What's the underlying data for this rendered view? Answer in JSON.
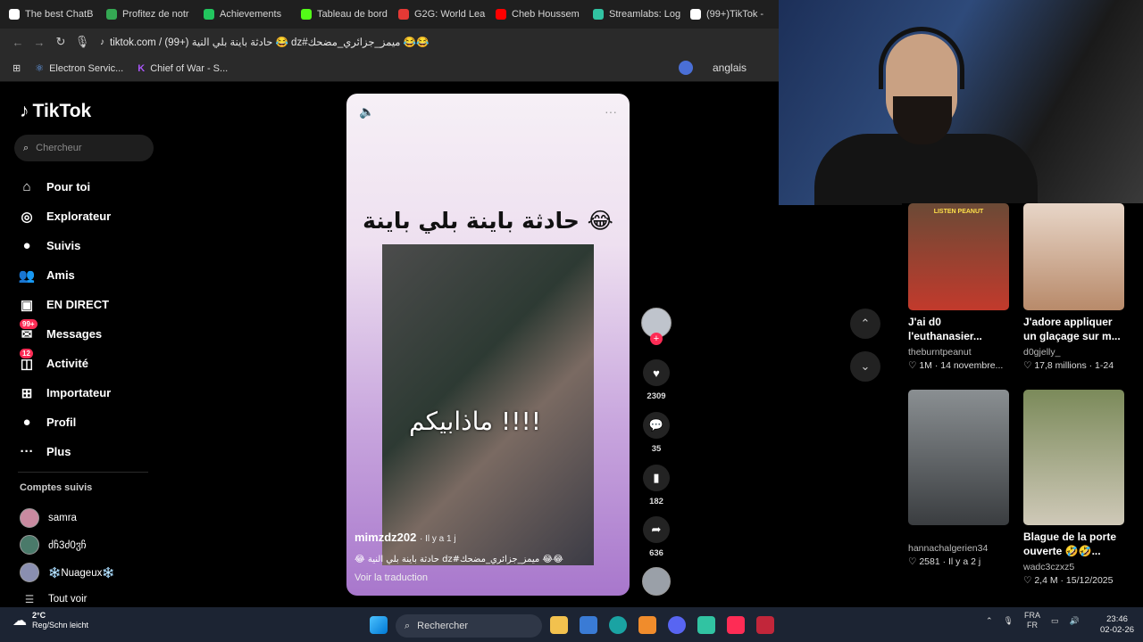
{
  "browser": {
    "tabs": [
      {
        "label": "The best ChatB",
        "color": "#ffffff"
      },
      {
        "label": "Profitez de notr",
        "color": "#34a853"
      },
      {
        "label": "Achievements",
        "color": "#22c55e"
      },
      {
        "label": "Tableau de bord",
        "color": "#53fc18"
      },
      {
        "label": "G2G: World Lea",
        "color": "#e53935"
      },
      {
        "label": "Cheb Houssem",
        "color": "#ff0000"
      },
      {
        "label": "Streamlabs: Log",
        "color": "#31c3a2"
      },
      {
        "label": "(99+)TikTok -",
        "color": "#ffffff"
      }
    ],
    "url": "tiktok.com / (99+) حادثة باينة بلي النية 😂 dz#ميمز_جزائري_مضحك 😂😂",
    "bookmarks": [
      "Electron Servic...",
      "Chief of War - S..."
    ],
    "translate_label": "anglais"
  },
  "sidebar": {
    "logo": "TikTok",
    "search_placeholder": "Chercheur",
    "items": [
      {
        "label": "Pour toi",
        "icon": "home-icon",
        "glyph": "⌂"
      },
      {
        "label": "Explorateur",
        "icon": "compass-icon",
        "glyph": "◎"
      },
      {
        "label": "Suivis",
        "icon": "following-icon",
        "glyph": "●"
      },
      {
        "label": "Amis",
        "icon": "friends-icon",
        "glyph": "👥"
      },
      {
        "label": "EN DIRECT",
        "icon": "live-icon",
        "glyph": "▣"
      },
      {
        "label": "Messages",
        "icon": "messages-icon",
        "glyph": "✉",
        "badge": "99+"
      },
      {
        "label": "Activité",
        "icon": "activity-icon",
        "glyph": "◫",
        "badge": "12"
      },
      {
        "label": "Importateur",
        "icon": "upload-icon",
        "glyph": "⊞"
      },
      {
        "label": "Profil",
        "icon": "profile-icon",
        "glyph": "●"
      },
      {
        "label": "Plus",
        "icon": "more-icon",
        "glyph": "···"
      }
    ],
    "following_title": "Comptes suivis",
    "following": [
      "samra",
      "ძჩ3ძ0ჳჩ",
      "❄️Nuageux❄️"
    ],
    "see_all": "Tout voir"
  },
  "video": {
    "title": "حادثة باينة بلي باينة 😂",
    "overlay_text": "ماذابيكم !!!!",
    "username": "mimzdz202",
    "time": "· Il y a 1 j",
    "description": "😂 حادثة باينة بلي النية dz#ميمز_جزائري_مضحك 😂😂",
    "translate": "Voir la traduction",
    "likes": "2309",
    "comments": "35",
    "saves": "182",
    "shares": "636"
  },
  "feed": [
    {
      "title": "J'ai d0 l'euthanasier...",
      "user": "theburntpeanut",
      "stats": "♡ 1M · 14 novembre...",
      "top_label": "LISTEN PEANUT",
      "color1": "#6b4a36",
      "color2": "#c23a2c"
    },
    {
      "title": "J'adore appliquer un glaçage sur m...",
      "user": "d0gjelly_",
      "stats": "♡ 17,8 millions · 1-24",
      "color1": "#e8d6c8",
      "color2": "#b88a6a"
    },
    {
      "title": "",
      "user": "hannachalgerien34",
      "stats": "♡ 2581 · Il y a 2 j",
      "color1": "#8a8f92",
      "color2": "#3a3d40"
    },
    {
      "title": "Blague de la porte ouverte 🤣🤣...",
      "user": "wadc3czxz5",
      "stats": "♡ 2,4 M · 15/12/2025",
      "color1": "#7b8a5a",
      "color2": "#cfc9b8"
    }
  ],
  "taskbar": {
    "temp": "2°C",
    "weather": "Reg/Schn leicht",
    "search": "Rechercher",
    "lang1": "FRA",
    "lang2": "FR",
    "time": "23:46",
    "date": "02-02-26"
  }
}
